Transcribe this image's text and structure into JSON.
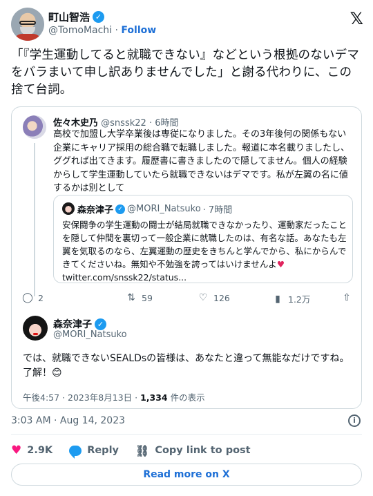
{
  "author": {
    "name": "町山智浩",
    "handle": "@TomoMachi",
    "separator": "·",
    "follow_label": "Follow"
  },
  "tweet": {
    "text": "「『学生運動してると就職できない』などという根拠のないデマをバラまいて申し訳ありませんでした」と謝る代わりに、この捨て台詞。",
    "timestamp": "3:03 AM · Aug 14, 2023"
  },
  "quote": {
    "reply": {
      "name": "佐々木史乃",
      "handle": "@snssk22",
      "time": "· 6時間",
      "text": "高校で加盟し大学卒業後は専従になりました。その3年後何の関係もない企業にキャリア採用の総合職で転職しました。報道に本名載りましたし、ググれば出てきます。履歴書に書きましたので隠してません。個人の経験からして学生運動していたら就職できないはデマです。私が左翼の名に値するかは別として"
    },
    "inner": {
      "name": "森奈津子",
      "handle": "@MORI_Natsuko",
      "time": "· 7時間",
      "text": "安保闘争の学生運動の闘士が結局就職できなかったり、運動家だったことを隠して仲間を裏切って一般企業に就職したのは、有名な話。あなたも左翼を気取るのなら、左翼運動の歴史をきちんと学んでから、私にからんできてくださいね。無知や不勉強を誇ってはいけませんよ",
      "link": "twitter.com/snssk22/status..."
    },
    "actions": {
      "replies": "2",
      "retweets": "59",
      "likes": "126",
      "views": "1.2万"
    },
    "main": {
      "name": "森奈津子",
      "handle": "@MORI_Natsuko",
      "text": "では、就職できないSEALDsの皆様は、あなたと違って無能なだけですね。了解！",
      "time": "午後4:57 · 2023年8月13日 · ",
      "views_count": "1,334",
      "views_label": " 件の表示"
    }
  },
  "actions": {
    "likes": "2.9K",
    "reply_label": "Reply",
    "copy_label": "Copy link to post"
  },
  "read_more_label": "Read more on X",
  "colors": {
    "accent": "#1d9bf0",
    "link": "#1d6fd6",
    "like": "#f91880"
  }
}
